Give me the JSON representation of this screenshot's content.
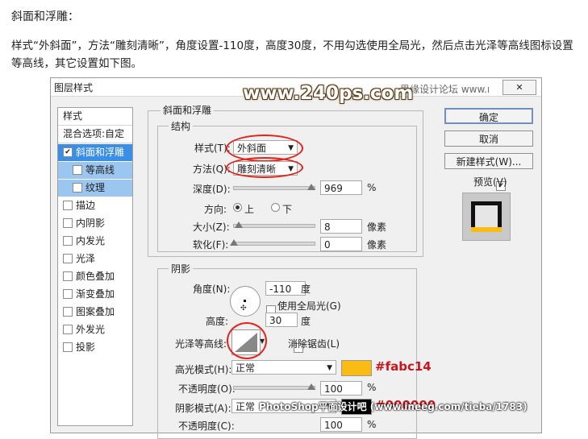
{
  "article": {
    "heading": "斜面和浮雕：",
    "paragraph": "样式“外斜面”，方法“雕刻清晰”，角度设置-110度，高度30度，不用勾选使用全局光，然后点击光泽等高线图标设置等高线，其它设置如下图。"
  },
  "dialog": {
    "title": "图层样式",
    "watermark": "www.240ps.com",
    "site_cn": "思缘设计论坛 www.missyuan.com",
    "close_label": "✕",
    "left_panel": {
      "header": "样式",
      "blend": "混合选项:自定",
      "items": [
        {
          "label": "斜面和浮雕",
          "checked": true
        },
        {
          "label": "等高线",
          "checked": false
        },
        {
          "label": "纹理",
          "checked": false
        },
        {
          "label": "描边",
          "checked": false
        },
        {
          "label": "内阴影",
          "checked": false
        },
        {
          "label": "内发光",
          "checked": false
        },
        {
          "label": "光泽",
          "checked": false
        },
        {
          "label": "颜色叠加",
          "checked": false
        },
        {
          "label": "渐变叠加",
          "checked": false
        },
        {
          "label": "图案叠加",
          "checked": false
        },
        {
          "label": "外发光",
          "checked": false
        },
        {
          "label": "投影",
          "checked": false
        }
      ]
    },
    "bevel": {
      "group_title": "斜面和浮雕",
      "structure_title": "结构",
      "style_label": "样式(T):",
      "style_value": "外斜面",
      "technique_label": "方法(Q):",
      "technique_value": "雕刻清晰",
      "depth_label": "深度(D):",
      "depth_value": "969",
      "depth_unit": "%",
      "direction_label": "方向:",
      "dir_up": "上",
      "dir_down": "下",
      "size_label": "大小(Z):",
      "size_value": "8",
      "size_unit": "像素",
      "soften_label": "软化(F):",
      "soften_value": "0",
      "soften_unit": "像素"
    },
    "shading": {
      "title": "阴影",
      "angle_label": "角度(N):",
      "angle_value": "-110",
      "angle_unit": "度",
      "global_light": "使用全局光(G)",
      "altitude_label": "高度:",
      "altitude_value": "30",
      "altitude_unit": "度",
      "gloss_label": "光泽等高线:",
      "antialias": "消除锯齿(L)",
      "highlight_mode_label": "高光模式(H):",
      "highlight_mode_value": "正常",
      "highlight_color": "#fabc14",
      "highlight_color_text": "#fabc14",
      "opacity1_label": "不透明度(O):",
      "opacity1_value": "100",
      "opacity1_unit": "%",
      "shadow_mode_label": "阴影模式(A):",
      "shadow_mode_value": "正常",
      "shadow_color": "#000000",
      "shadow_color_text": "#000000",
      "opacity2_label": "不透明度(C):",
      "opacity2_value": "100",
      "opacity2_unit": "%"
    },
    "buttons": {
      "ok": "确定",
      "cancel": "取消",
      "new_style": "新建样式(W)...",
      "preview": "预览(V)"
    },
    "bottom_watermark": "PhotoShop平面设计吧 (www.ineeg.com/tieba/1783)"
  }
}
